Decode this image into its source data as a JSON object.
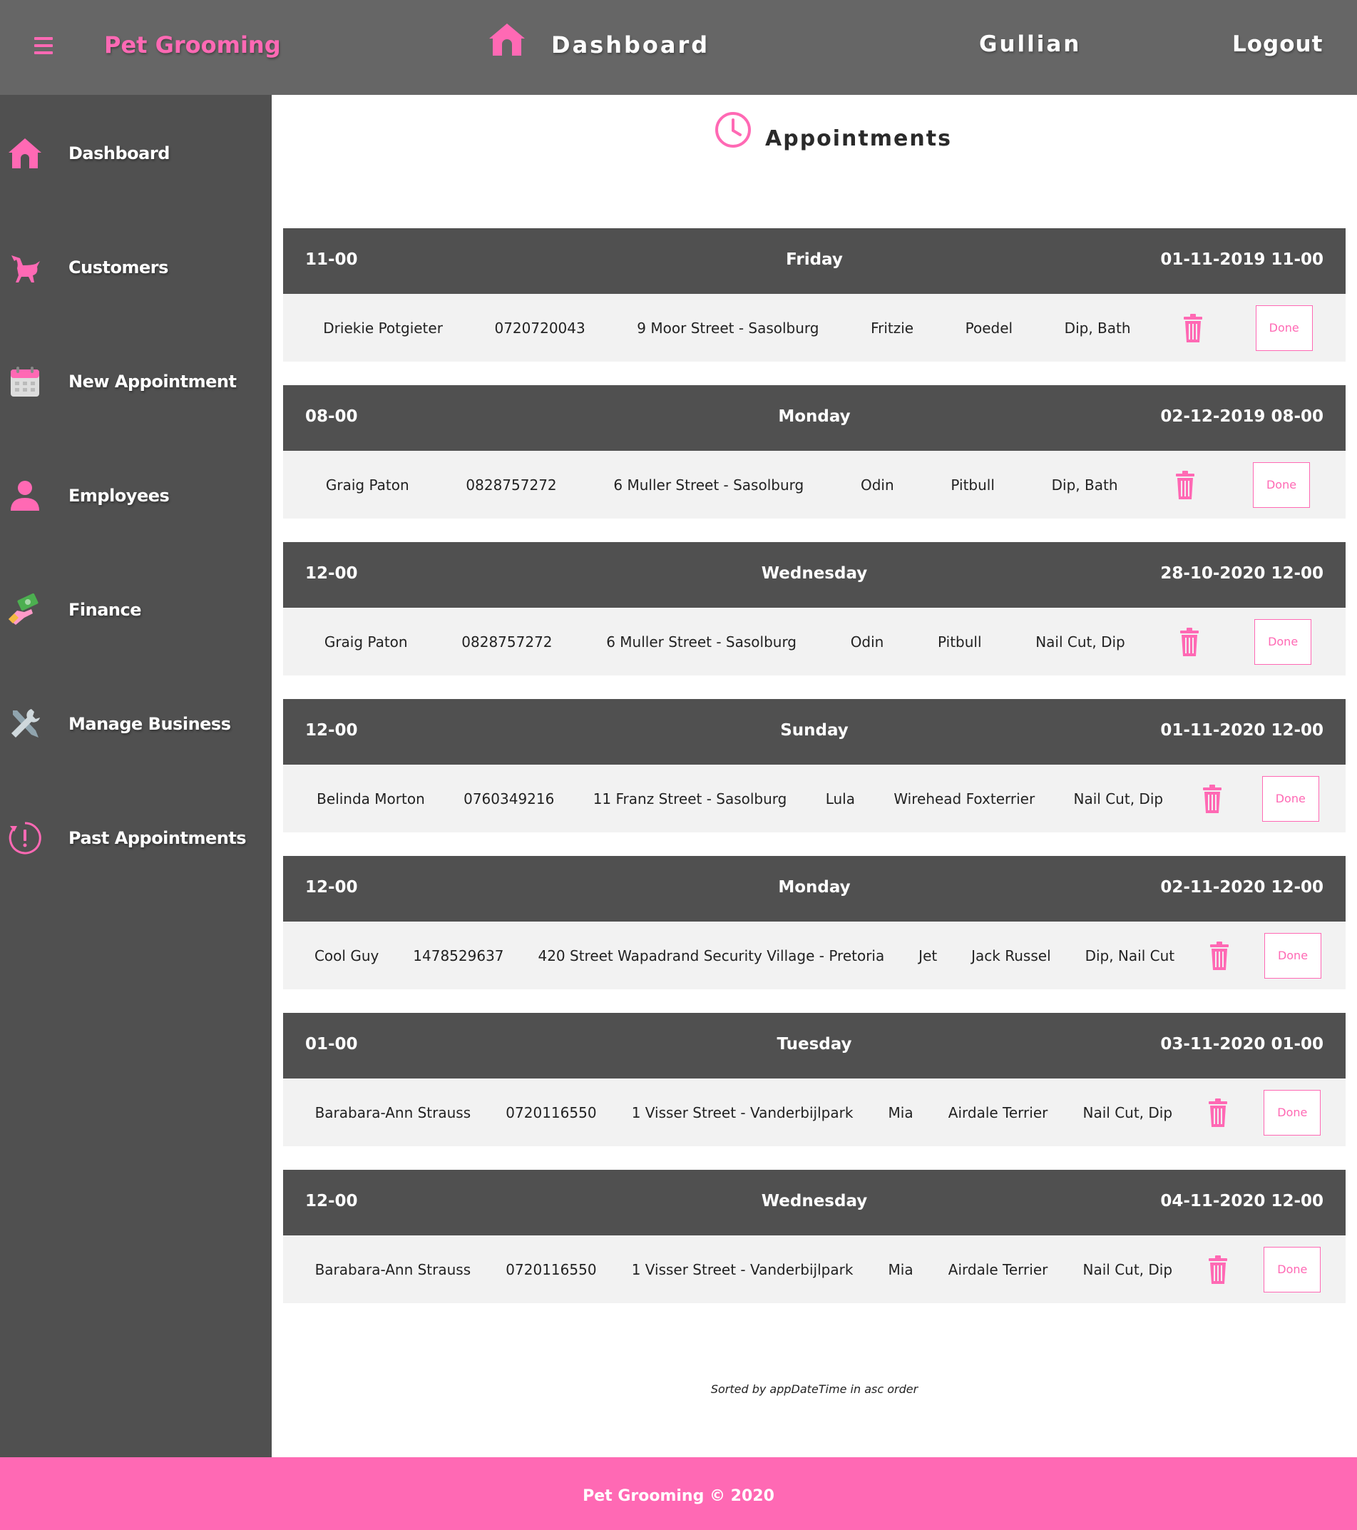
{
  "header": {
    "brand": "Pet Grooming",
    "title": "Dashboard",
    "user": "Gullian",
    "logout": "Logout"
  },
  "sidebar": {
    "items": [
      {
        "label": "Dashboard",
        "icon": "home-icon"
      },
      {
        "label": "Customers",
        "icon": "dog-icon"
      },
      {
        "label": "New Appointment",
        "icon": "calendar-icon"
      },
      {
        "label": "Employees",
        "icon": "person-icon"
      },
      {
        "label": "Finance",
        "icon": "money-icon"
      },
      {
        "label": "Manage Business",
        "icon": "tools-icon"
      },
      {
        "label": "Past Appointments",
        "icon": "history-icon"
      }
    ]
  },
  "main": {
    "title": "Appointments",
    "sorted_note": "Sorted by appDateTime in asc order",
    "done_label": "Done",
    "appointments": [
      {
        "time": "11-00",
        "day": "Friday",
        "datetime": "01-11-2019 11-00",
        "customer": "Driekie Potgieter",
        "phone": "0720720043",
        "address": "9 Moor Street - Sasolburg",
        "pet": "Fritzie",
        "breed": "Poedel",
        "services": "Dip, Bath"
      },
      {
        "time": "08-00",
        "day": "Monday",
        "datetime": "02-12-2019 08-00",
        "customer": "Graig Paton",
        "phone": "0828757272",
        "address": "6 Muller Street - Sasolburg",
        "pet": "Odin",
        "breed": "Pitbull",
        "services": "Dip, Bath"
      },
      {
        "time": "12-00",
        "day": "Wednesday",
        "datetime": "28-10-2020 12-00",
        "customer": "Graig Paton",
        "phone": "0828757272",
        "address": "6 Muller Street - Sasolburg",
        "pet": "Odin",
        "breed": "Pitbull",
        "services": "Nail Cut, Dip"
      },
      {
        "time": "12-00",
        "day": "Sunday",
        "datetime": "01-11-2020 12-00",
        "customer": "Belinda Morton",
        "phone": "0760349216",
        "address": "11 Franz Street - Sasolburg",
        "pet": "Lula",
        "breed": "Wirehead Foxterrier",
        "services": "Nail Cut, Dip"
      },
      {
        "time": "12-00",
        "day": "Monday",
        "datetime": "02-11-2020 12-00",
        "customer": "Cool Guy",
        "phone": "1478529637",
        "address": "420 Street Wapadrand Security Village - Pretoria",
        "pet": "Jet",
        "breed": "Jack Russel",
        "services": "Dip, Nail Cut"
      },
      {
        "time": "01-00",
        "day": "Tuesday",
        "datetime": "03-11-2020 01-00",
        "customer": "Barabara-Ann Strauss",
        "phone": "0720116550",
        "address": "1 Visser Street - Vanderbijlpark",
        "pet": "Mia",
        "breed": "Airdale Terrier",
        "services": "Nail Cut, Dip"
      },
      {
        "time": "12-00",
        "day": "Wednesday",
        "datetime": "04-11-2020 12-00",
        "customer": "Barabara-Ann Strauss",
        "phone": "0720116550",
        "address": "1 Visser Street - Vanderbijlpark",
        "pet": "Mia",
        "breed": "Airdale Terrier",
        "services": "Nail Cut, Dip"
      }
    ]
  },
  "footer": {
    "text": "Pet Grooming © 2020"
  },
  "colors": {
    "accent": "#ff69b4",
    "header_bg": "#666666",
    "sidebar_bg": "#505050",
    "row_bg": "#f2f2f2"
  }
}
